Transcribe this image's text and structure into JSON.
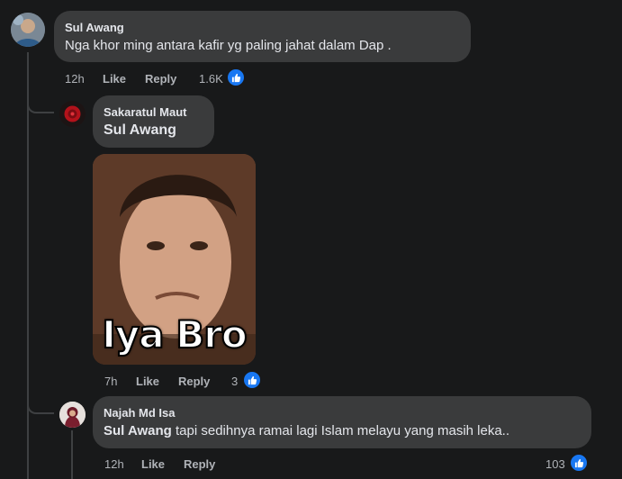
{
  "comments": [
    {
      "author": "Sul Awang",
      "text": "Nga khor ming antara kafir yg paling jahat dalam Dap .",
      "time": "12h",
      "like_label": "Like",
      "reply_label": "Reply",
      "reactions": "1.6K"
    },
    {
      "author": "Sakaratul Maut",
      "mention": "Sul Awang",
      "gif_caption": "Iya Bro",
      "time": "7h",
      "like_label": "Like",
      "reply_label": "Reply",
      "reactions": "3"
    },
    {
      "author": "Najah Md Isa",
      "mention": "Sul Awang",
      "text": " tapi sedihnya ramai lagi Islam melayu yang masih leka..",
      "time": "12h",
      "like_label": "Like",
      "reply_label": "Reply",
      "reactions": "103"
    }
  ],
  "colors": {
    "background": "#18191a",
    "bubble": "#3a3b3c",
    "like_blue": "#1877f2",
    "meta_text": "#b0b3b8"
  }
}
